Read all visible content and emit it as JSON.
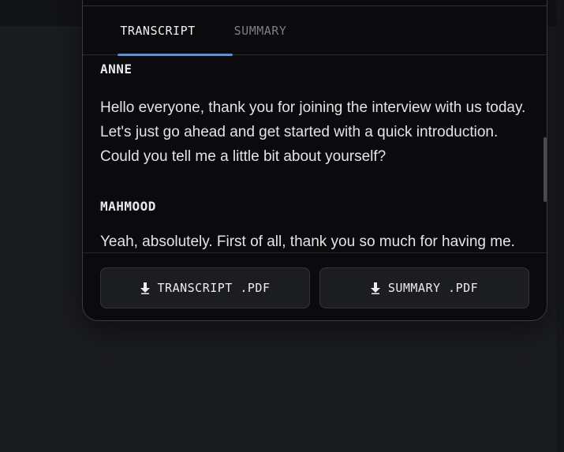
{
  "tabs": {
    "transcript_label": "TRANSCRIPT",
    "summary_label": "SUMMARY",
    "active": "transcript"
  },
  "transcript": {
    "entries": [
      {
        "speaker": "ANNE",
        "text": "Hello everyone, thank you for joining the interview with us today. Let's just go ahead and get started with a quick introduction. Could you tell me a little bit about yourself?"
      },
      {
        "speaker": "MAHMOOD",
        "text": "Yeah, absolutely. First of all, thank you so much for having me."
      }
    ]
  },
  "footer": {
    "transcript_pdf_label": "TRANSCRIPT .PDF",
    "summary_pdf_label": "SUMMARY .PDF",
    "download_icon": "download-arrow-icon"
  },
  "colors": {
    "accent": "#5b8fd8",
    "panel_bg": "#0b0b0d",
    "page_bg": "#1a1b1e"
  }
}
